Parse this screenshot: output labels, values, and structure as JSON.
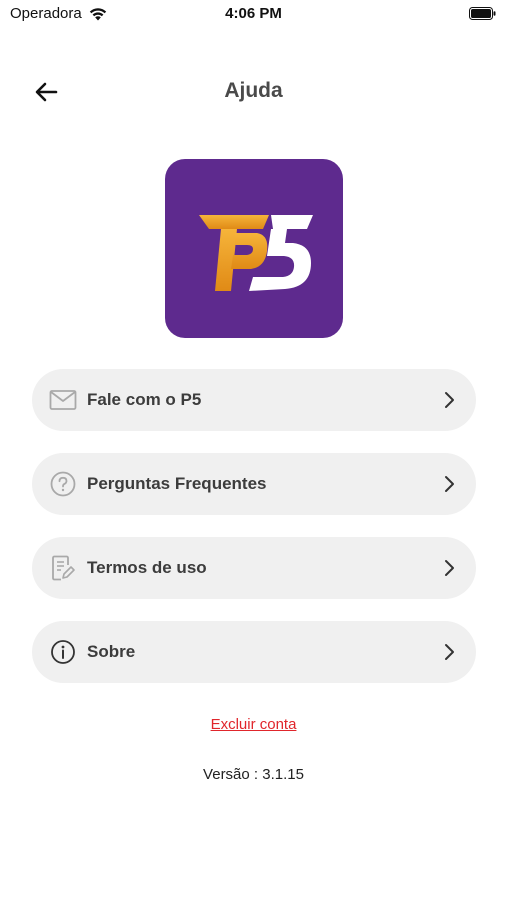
{
  "status_bar": {
    "carrier": "Operadora",
    "time": "4:06 PM"
  },
  "header": {
    "title": "Ajuda"
  },
  "logo": {
    "text": "P5",
    "background": "#5e2a8e"
  },
  "menu": [
    {
      "label": "Fale com o P5",
      "icon": "mail-icon"
    },
    {
      "label": "Perguntas Frequentes",
      "icon": "help-circle-icon"
    },
    {
      "label": "Termos de uso",
      "icon": "document-edit-icon"
    },
    {
      "label": "Sobre",
      "icon": "info-icon"
    }
  ],
  "delete_account": {
    "label": "Excluir conta",
    "color": "#e0262c"
  },
  "version": {
    "text": "Versão : 3.1.15"
  }
}
